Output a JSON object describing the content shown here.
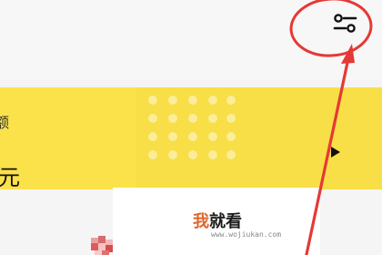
{
  "card": {
    "label_top": "额",
    "value": "元"
  },
  "watermark": {
    "title_first": "我",
    "title_rest": "就看",
    "url": "www.wojiukan.com"
  },
  "icons": {
    "filter": "filter-sliders-icon",
    "chevron": "chevron-right-icon",
    "dots": "dot-grid-icon"
  },
  "colors": {
    "card_yellow": "#fbe14a",
    "annotation_red": "#e53935",
    "watermark_accent": "#e0662b"
  }
}
